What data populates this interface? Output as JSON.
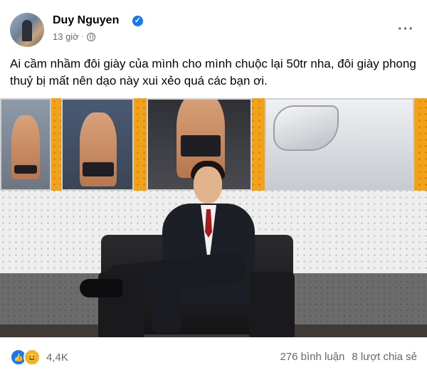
{
  "post": {
    "author": "Duy Nguyen",
    "verified_icon": "verified-badge-icon",
    "timestamp": "13 giờ",
    "separator": "·",
    "audience_icon": "globe-icon",
    "more_label": "···",
    "text": "Ai cầm nhầm đôi giày của mình cho mình chuộc lại 50tr nha, đôi giày phong thuỷ bị mất nên dạo này xui xẻo quá các bạn ơi.",
    "photo_icon": "photo"
  },
  "footer": {
    "reactions": [
      "like-icon",
      "haha-icon"
    ],
    "reaction_count": "4,4K",
    "comments": "276 bình luận",
    "shares": "8 lượt chia sẻ"
  },
  "colors": {
    "accent": "#1877f2",
    "text": "#050505",
    "secondary": "#65676b",
    "haha": "#f7b125"
  }
}
